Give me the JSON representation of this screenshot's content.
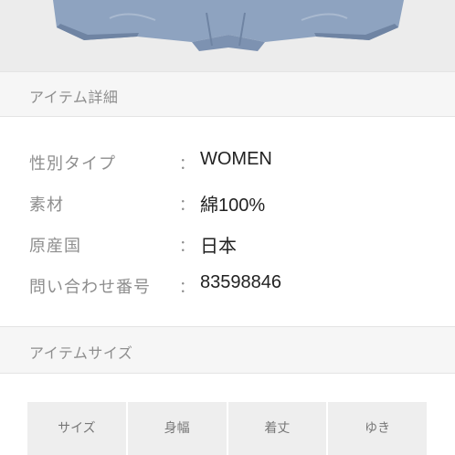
{
  "product_image": {
    "alt": "",
    "colors": {
      "background": "#ececec",
      "fabric": "#8ea3c0",
      "fabric_dark": "#6f84a3"
    }
  },
  "detail_section": {
    "title": "アイテム詳細",
    "rows": [
      {
        "label": "性別タイプ",
        "colon": "：",
        "value": "WOMEN"
      },
      {
        "label": "素材",
        "colon": "：",
        "value": "綿100%"
      },
      {
        "label": "原産国",
        "colon": "：",
        "value": "日本"
      },
      {
        "label": "問い合わせ番号",
        "colon": "：",
        "value": "83598846"
      }
    ]
  },
  "size_section": {
    "title": "アイテムサイズ",
    "columns": [
      "サイズ",
      "身幅",
      "着丈",
      "ゆき"
    ]
  }
}
